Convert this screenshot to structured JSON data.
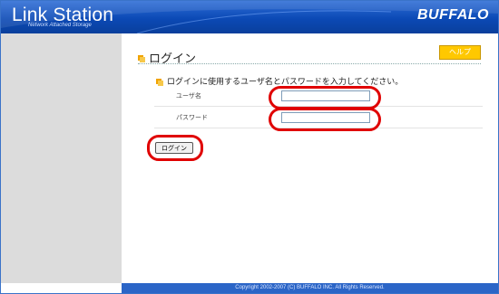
{
  "header": {
    "logo_text": "Link Station",
    "logo_subtext": "Network Attached Storage",
    "brand": "BUFFALO"
  },
  "main": {
    "title": "ログイン",
    "help_label": "ヘルプ",
    "instruction": "ログインに使用するユーザ名とパスワードを入力してください。",
    "username_label": "ユーザ名",
    "username_value": "",
    "password_label": "パスワード",
    "password_value": "",
    "login_button": "ログイン"
  },
  "footer": {
    "copyright": "Copyright 2002-2007 (C) BUFFALO INC. All Rights Reserved."
  },
  "colors": {
    "header_blue": "#0b49b5",
    "sidebar_gray": "#dcdcdc",
    "help_yellow": "#ffc800",
    "annotation_red": "#e00000",
    "footer_blue": "#2b65c7"
  }
}
